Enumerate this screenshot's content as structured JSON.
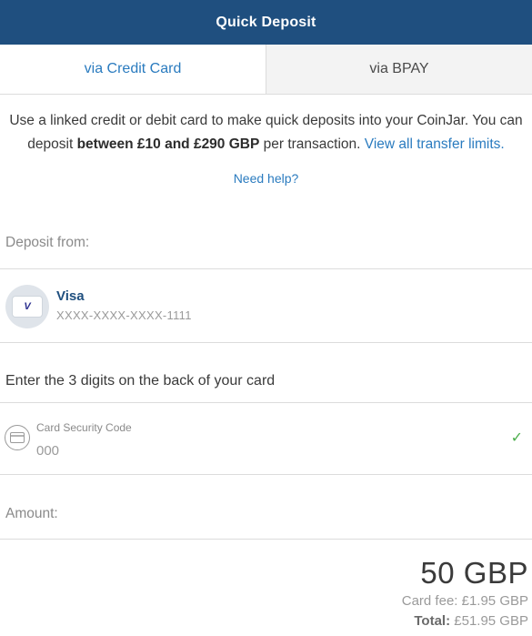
{
  "header": {
    "title": "Quick Deposit"
  },
  "tabs": [
    {
      "label": "via Credit Card",
      "active": true
    },
    {
      "label": "via BPAY",
      "active": false
    }
  ],
  "info": {
    "text_1": "Use a linked credit or debit card to make quick deposits into your CoinJar. You can deposit ",
    "limits": "between £10 and £290 GBP",
    "text_2": " per transaction. ",
    "link": "View all transfer limits."
  },
  "help": {
    "label": "Need help?"
  },
  "deposit_from": {
    "label": "Deposit from:"
  },
  "card": {
    "brand_badge": "V",
    "name": "Visa",
    "number": "XXXX-XXXX-XXXX-1111"
  },
  "cvc": {
    "prompt": "Enter the 3 digits on the back of your card",
    "label": "Card Security Code",
    "placeholder": "000",
    "check": "✓"
  },
  "amount": {
    "label": "Amount:",
    "value": "50 GBP",
    "fee": "Card fee: £1.95 GBP",
    "total_label": "Total:",
    "total_value": "£51.95 GBP"
  },
  "colors": {
    "header_bg": "#1f4f7f",
    "link": "#2a7bbf",
    "check": "#4cae4c"
  }
}
